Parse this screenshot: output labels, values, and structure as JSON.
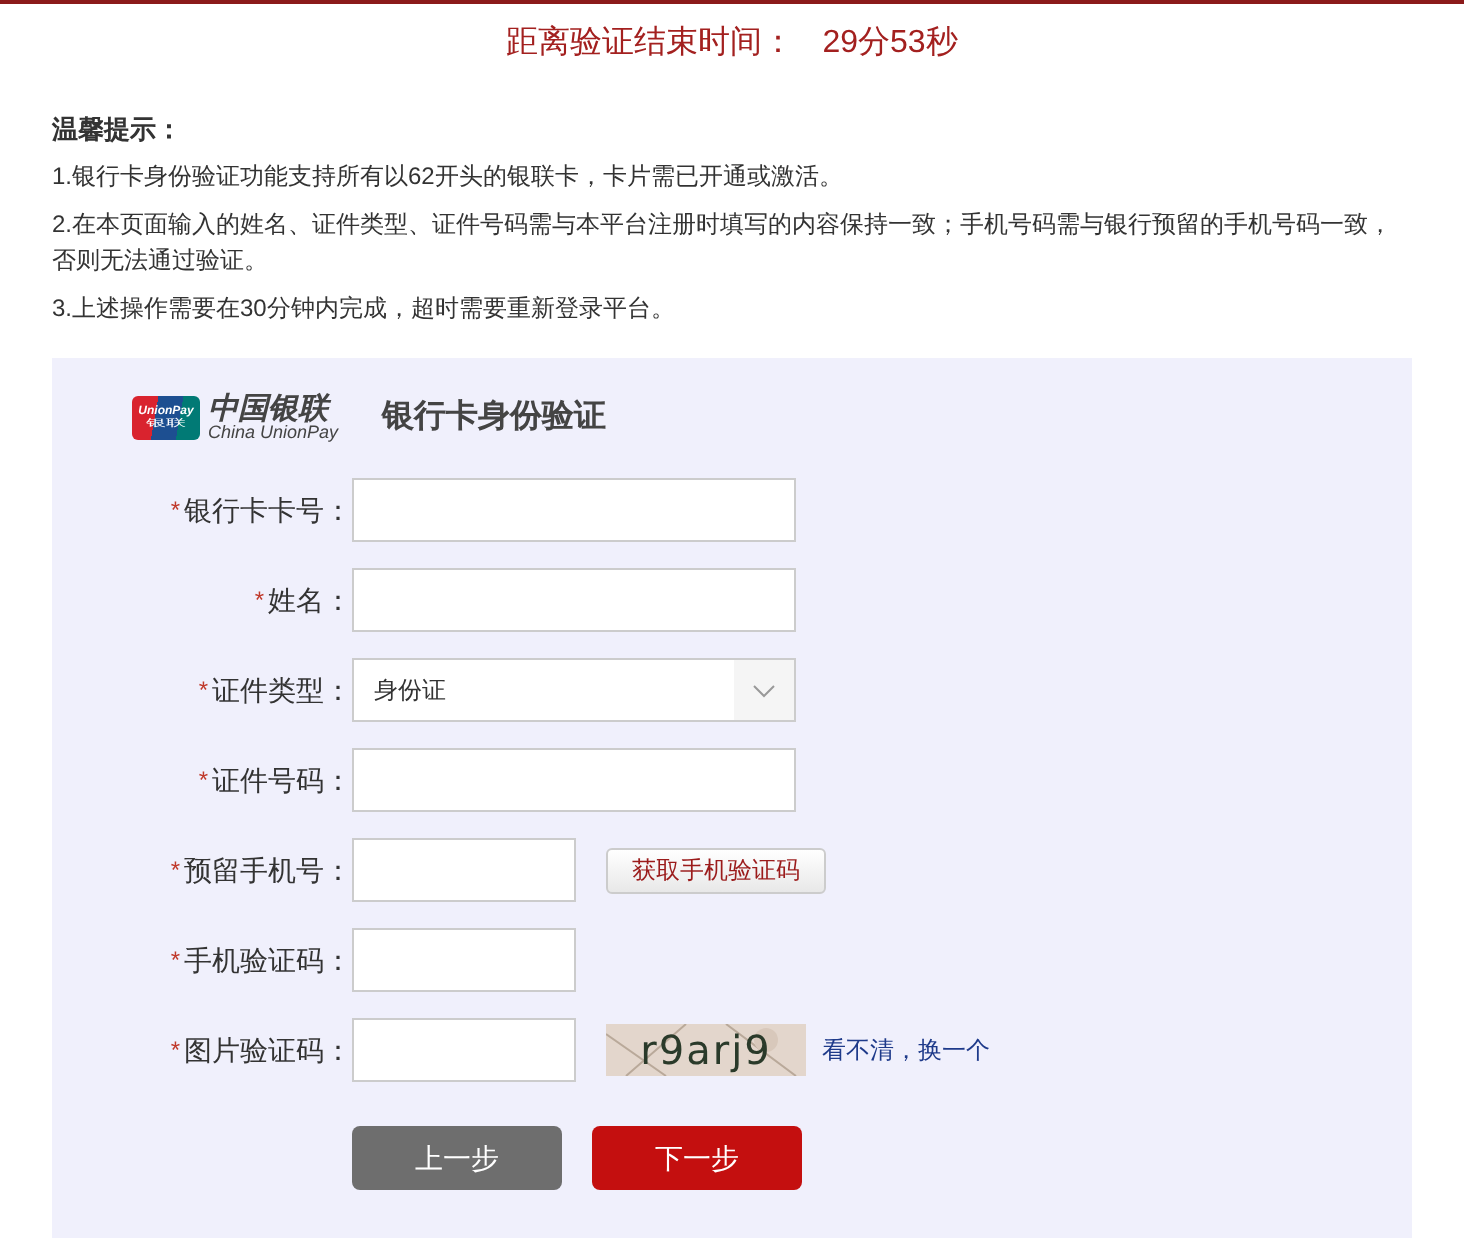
{
  "countdown": {
    "label": "距离验证结束时间：",
    "time": "29分53秒"
  },
  "tips": {
    "title": "温馨提示：",
    "items": [
      "1.银行卡身份验证功能支持所有以62开头的银联卡，卡片需已开通或激活。",
      "2.在本页面输入的姓名、证件类型、证件号码需与本平台注册时填写的内容保持一致；手机号码需与银行预留的手机号码一致，否则无法通过验证。",
      "3.上述操作需要在30分钟内完成，超时需要重新登录平台。"
    ]
  },
  "form": {
    "logo": {
      "card_text": "UnionPay",
      "card_cn": "银联",
      "name": "中国银联",
      "name_en": "China UnionPay"
    },
    "title": "银行卡身份验证",
    "fields": [
      {
        "kind": "text",
        "marker": "*",
        "label": "银行卡卡号："
      },
      {
        "kind": "text",
        "marker": "*",
        "label": "姓名："
      },
      {
        "kind": "select",
        "marker": "*",
        "label": "证件类型：",
        "value": "身份证"
      },
      {
        "kind": "text",
        "marker": "*",
        "label": "证件号码："
      },
      {
        "kind": "sms",
        "marker": "*",
        "label": "预留手机号：",
        "button": "获取手机验证码"
      },
      {
        "kind": "short",
        "marker": "*",
        "label": "手机验证码："
      },
      {
        "kind": "captcha",
        "marker": "*",
        "label": "图片验证码：",
        "captcha": "r9arj9",
        "refresh": "看不清，换一个"
      }
    ],
    "buttons": [
      {
        "kind": "back",
        "label": "上一步"
      },
      {
        "kind": "next",
        "label": "下一步"
      }
    ]
  }
}
